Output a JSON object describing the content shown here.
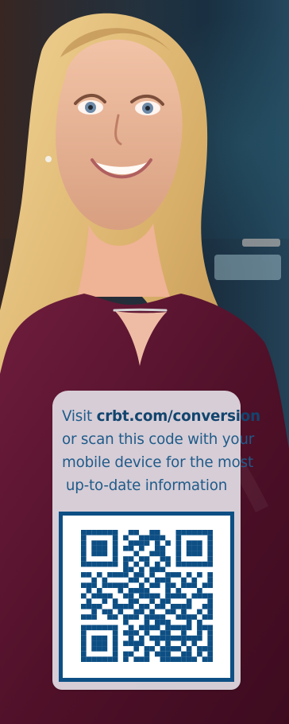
{
  "promo": {
    "line1_prefix": "Visit ",
    "line1_link": "crbt.com/conversion",
    "line2": "or scan this code with your",
    "line3": "mobile device for the most",
    "line4": "up-to-date information"
  },
  "qr": {
    "primary_color": "#0d4f84",
    "background_color": "#ffffff"
  }
}
